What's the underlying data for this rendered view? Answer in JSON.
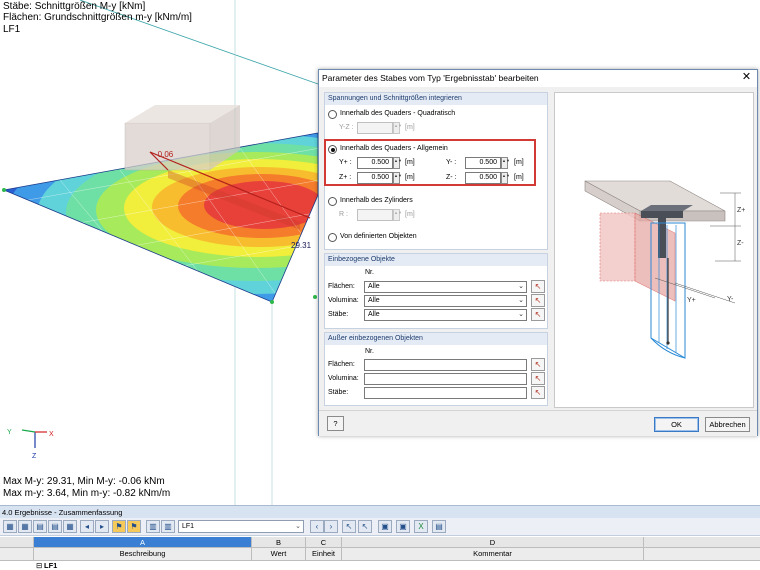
{
  "viewport": {
    "info_lines": [
      "Stäbe: Schnittgrößen M-y [kNm]",
      "Flächen: Grundschnittgrößen m-y [kNm/m]",
      "LF1"
    ],
    "bottom_lines": [
      "Max M-y: 29.31, Min M-y: -0.06 kNm",
      "Max m-y: 3.64, Min m-y: -0.82 kNm/m"
    ],
    "label_min": "-0.06",
    "label_max": "29.31",
    "axes": {
      "y": "Y",
      "x": "X",
      "z": "Z"
    }
  },
  "dialog": {
    "title": "Parameter des Stabes vom Typ 'Ergebnisstab' bearbeiten",
    "close": "✕",
    "section1": {
      "header": "Spannungen und Schnittgrößen integrieren",
      "opt_quadratisch": "Innerhalb des Quaders - Quadratisch",
      "yz_label": "Y-Z :",
      "yz_value": "",
      "unit_m": "[m]",
      "opt_allgemein": "Innerhalb des Quaders - Allgemein",
      "yplus_label": "Y+ :",
      "yplus_value": "0.500",
      "yminus_label": "Y- :",
      "yminus_value": "0.500",
      "zplus_label": "Z+ :",
      "zplus_value": "0.500",
      "zminus_label": "Z- :",
      "zminus_value": "0.500",
      "opt_zylinder": "Innerhalb des Zylinders",
      "r_label": "R :",
      "r_value": "",
      "opt_objekte": "Von definierten Objekten"
    },
    "section2": {
      "header": "Einbezogene Objekte",
      "nr": "Nr.",
      "flaechen_label": "Flächen:",
      "flaechen_value": "Alle",
      "volumina_label": "Volumina:",
      "volumina_value": "Alle",
      "staebe_label": "Stäbe:",
      "staebe_value": "Alle"
    },
    "section3": {
      "header": "Außer einbezogenen Objekten",
      "nr": "Nr.",
      "flaechen_label": "Flächen:",
      "volumina_label": "Volumina:",
      "staebe_label": "Stäbe:"
    },
    "diagram_labels": {
      "zplus": "Z+",
      "zminus": "Z-",
      "yplus": "Y+",
      "yminus": "Y-"
    },
    "ok": "OK",
    "cancel": "Abbrechen"
  },
  "results": {
    "panel_title": "4.0 Ergebnisse - Zusammenfassung",
    "load_case": "LF1",
    "col_letters": [
      "A",
      "B",
      "C",
      "D"
    ],
    "col_names": [
      "Beschreibung",
      "Wert",
      "Einheit",
      "Kommentar"
    ],
    "row1": "LF1"
  }
}
